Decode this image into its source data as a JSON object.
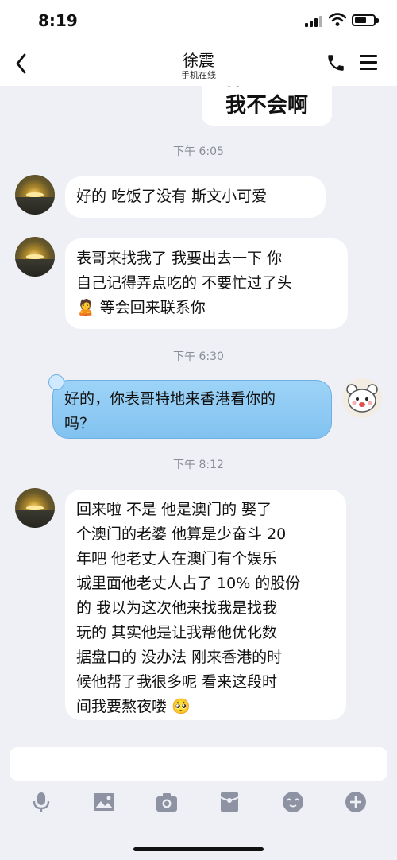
{
  "status_bar": {
    "time": "8:19"
  },
  "header": {
    "contact_name": "徐震",
    "contact_status": "手机在线"
  },
  "messages": [
    {
      "type": "image_partial",
      "text": "我不会啊",
      "side": "right"
    },
    {
      "type": "timestamp",
      "text": "下午 6:05"
    },
    {
      "type": "text",
      "side": "left",
      "lines": [
        "好的  吃饭了没有  斯文小可爱"
      ]
    },
    {
      "type": "text",
      "side": "left",
      "lines": [
        "表哥来找我了  我要出去一下  你",
        "自己记得弄点吃的 不要忙过了头",
        "🙎  等会回来联系你"
      ]
    },
    {
      "type": "timestamp",
      "text": "下午 6:30"
    },
    {
      "type": "text",
      "side": "right",
      "lines": [
        "好的，你表哥特地来香港看你的",
        "吗？"
      ]
    },
    {
      "type": "timestamp",
      "text": "下午 8:12"
    },
    {
      "type": "text",
      "side": "left",
      "lines": [
        "回来啦  不是  他是澳门的  娶了",
        "个澳门的老婆  他算是少奋斗 20",
        "年吧  他老丈人在澳门有个娱乐",
        "城里面他老丈人占了 10% 的股份",
        "的  我以为这次他来找我是找我",
        "玩的  其实他是让我帮他优化数",
        "据盘口的  没办法 刚来香港的时",
        "候他帮了我很多呢  看来这段时",
        "间我要熬夜喽 🥺"
      ]
    }
  ],
  "input": {
    "placeholder": ""
  },
  "toolbar": {
    "icons": [
      "microphone-icon",
      "image-icon",
      "camera-icon",
      "red-packet-icon",
      "emoji-icon",
      "plus-icon"
    ]
  },
  "colors": {
    "background": "#eef0f6",
    "bubble_left": "#ffffff",
    "bubble_right": "#8ecbf4",
    "timestamp": "#8a8d95"
  }
}
